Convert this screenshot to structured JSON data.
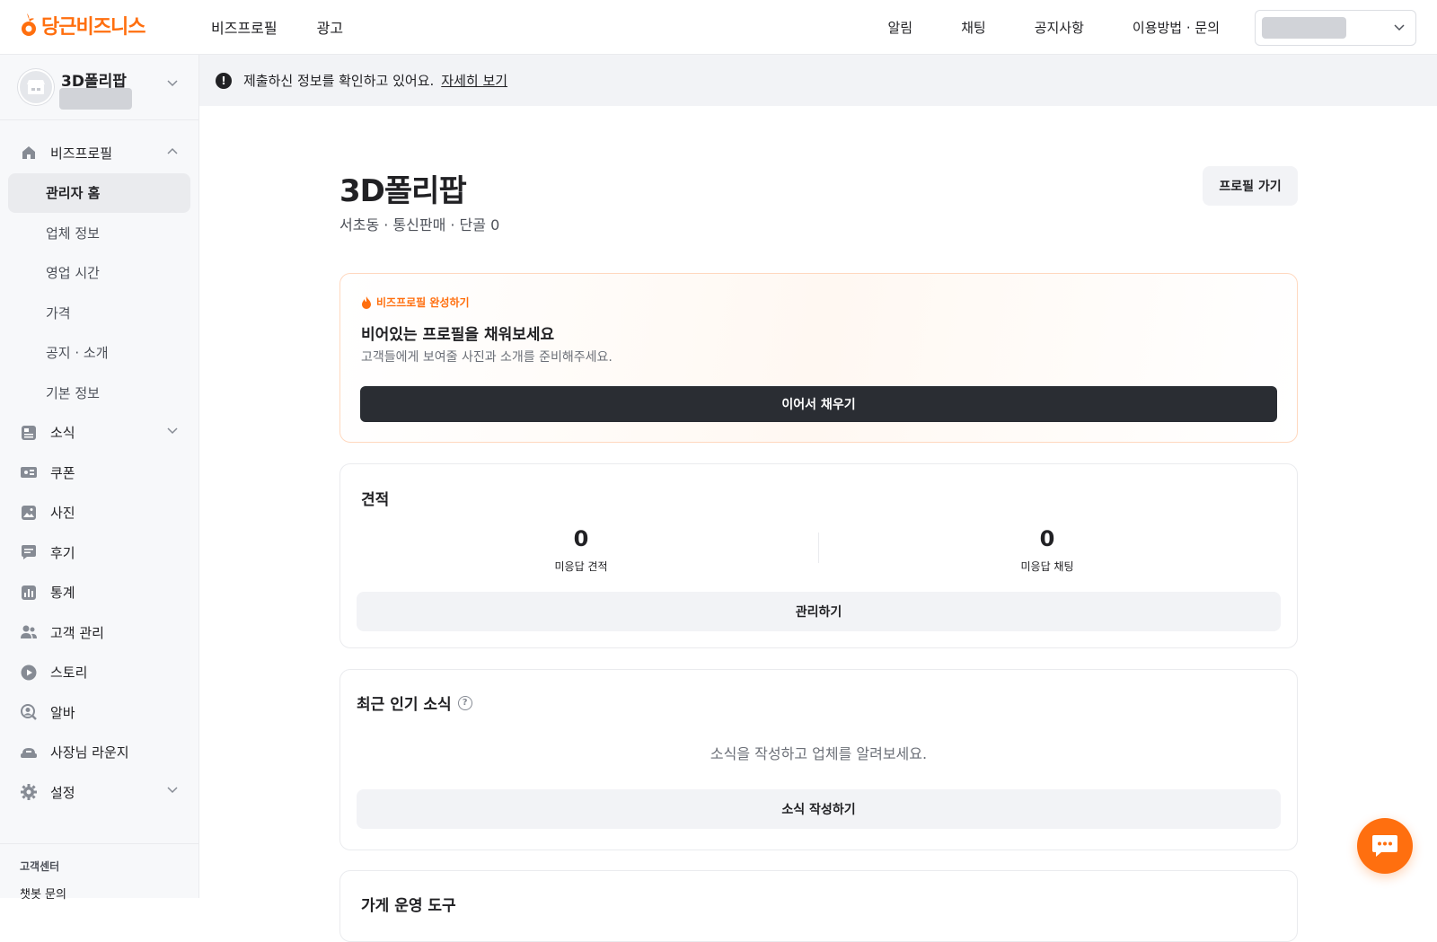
{
  "brand": {
    "name": "당근비즈니스",
    "accent": "#ff6f0f"
  },
  "topnav": {
    "left": [
      {
        "label": "비즈프로필"
      },
      {
        "label": "광고"
      }
    ],
    "right": [
      {
        "label": "알림"
      },
      {
        "label": "채팅"
      },
      {
        "label": "공지사항"
      },
      {
        "label": "이용방법 · 문의"
      }
    ]
  },
  "sidebar": {
    "business_name": "3D폴리팝",
    "profile_section": {
      "label": "비즈프로필",
      "sub_items": [
        {
          "label": "관리자 홈"
        },
        {
          "label": "업체 정보"
        },
        {
          "label": "영업 시간"
        },
        {
          "label": "가격"
        },
        {
          "label": "공지 · 소개"
        },
        {
          "label": "기본 정보"
        }
      ]
    },
    "items": [
      {
        "label": "소식",
        "icon": "news-icon"
      },
      {
        "label": "쿠폰",
        "icon": "coupon-icon"
      },
      {
        "label": "사진",
        "icon": "photo-icon"
      },
      {
        "label": "후기",
        "icon": "review-icon"
      },
      {
        "label": "통계",
        "icon": "stats-icon"
      },
      {
        "label": "고객 관리",
        "icon": "customers-icon"
      },
      {
        "label": "스토리",
        "icon": "story-icon"
      },
      {
        "label": "알바",
        "icon": "job-icon"
      },
      {
        "label": "사장님 라운지",
        "icon": "lounge-icon"
      },
      {
        "label": "설정",
        "icon": "gear-icon"
      }
    ],
    "footer": {
      "section": "고객센터",
      "link": "챗봇 문의"
    }
  },
  "notice": {
    "text": "제출하신 정보를 확인하고 있어요.",
    "link": "자세히 보기"
  },
  "main": {
    "title": "3D폴리팝",
    "subtitle": "서초동 · 통신판매 · 단골 0",
    "profile_button": "프로필 가기",
    "complete_card": {
      "tag": "비즈프로필 완성하기",
      "title": "비어있는 프로필을 채워보세요",
      "description": "고객들에게 보여줄 사진과 소개를 준비해주세요.",
      "button": "이어서 채우기"
    },
    "quote_card": {
      "title": "견적",
      "stats": [
        {
          "value": "0",
          "label": "미응답 견적"
        },
        {
          "value": "0",
          "label": "미응답 채팅"
        }
      ],
      "button": "관리하기"
    },
    "news_card": {
      "title": "최근 인기 소식",
      "empty_text": "소식을 작성하고 업체를 알려보세요.",
      "button": "소식 작성하기"
    },
    "tools_card": {
      "title": "가게 운영 도구"
    }
  }
}
